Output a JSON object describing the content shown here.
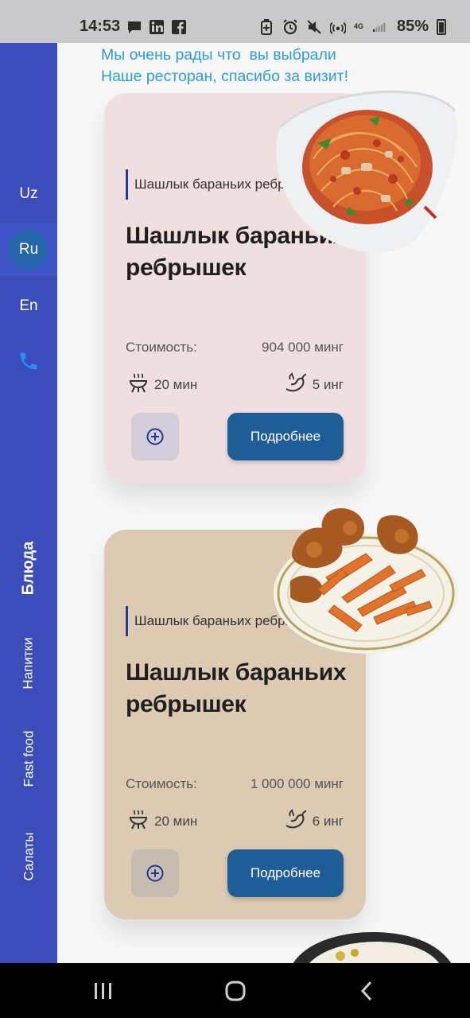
{
  "status_bar": {
    "time": "14:53",
    "battery": "85%",
    "network": "4G",
    "left_icons": [
      "message-icon",
      "linkedin-icon",
      "facebook-icon"
    ],
    "right_icons": [
      "battery-saver-icon",
      "alarm-icon",
      "mute-icon",
      "hotspot-icon",
      "signal-icon",
      "battery-icon"
    ]
  },
  "sidebar": {
    "languages": [
      {
        "label": "Uz",
        "active": false
      },
      {
        "label": "Ru",
        "active": true
      },
      {
        "label": "En",
        "active": false
      }
    ],
    "phone_icon": "phone-icon",
    "categories": [
      {
        "label": "Блюда",
        "active": true
      },
      {
        "label": "Напитки",
        "active": false
      },
      {
        "label": "Fast food",
        "active": false
      },
      {
        "label": "Салаты",
        "active": false
      }
    ]
  },
  "greeting": {
    "line1": "Мы очень рады что  вы выбрали",
    "line2": "Наше ресторан, спасибо за визит!"
  },
  "cards": [
    {
      "tag": "Шашлык бараньих ребрышек",
      "title": "Шашлык бараньих ребрышек",
      "price_label": "Стоимость:",
      "price": "904 000 минг",
      "time": "20 мин",
      "ingredients": "5 инг",
      "button": "Подробнее",
      "bg_color": "#f0dfe0"
    },
    {
      "tag": "Шашлык бараньих ребрышек",
      "title": "Шашлык бараньих ребрышек",
      "price_label": "Стоимость:",
      "price": "1 000 000 минг",
      "time": "20 мин",
      "ingredients": "6 инг",
      "button": "Подробнее",
      "bg_color": "#dccab3"
    }
  ],
  "colors": {
    "sidebar": "#3b4db8",
    "accent_button": "#1e5d96",
    "greeting_text": "#2d9bdc",
    "active_lang": "#2466a9"
  }
}
